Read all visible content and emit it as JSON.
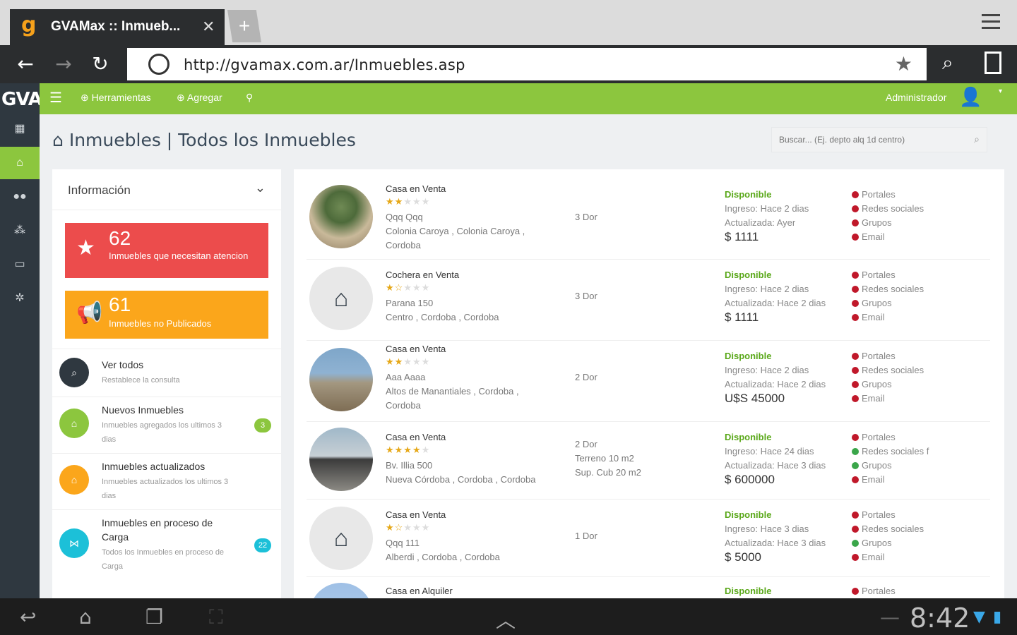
{
  "browser": {
    "tab_title": "GVAMax :: Inmueb...",
    "tab_close": "✕",
    "new_tab": "+",
    "url": "http://gvamax.com.ar/Inmuebles.asp"
  },
  "sidebar": {
    "logo": "GVA",
    "items": [
      "dashboard-icon",
      "home-icon",
      "users-icon",
      "network-icon",
      "calendar-icon",
      "gear-icon"
    ],
    "active_index": 1
  },
  "appbar": {
    "menu": "☰",
    "tools": "Herramientas",
    "add": "Agregar",
    "user": "Administrador"
  },
  "page": {
    "title": "Inmuebles | Todos los Inmuebles",
    "search_placeholder": "Buscar... (Ej. depto alq 1d centro)"
  },
  "info": {
    "title": "Información",
    "stat_attention": {
      "count": "62",
      "label": "Inmuebles que necesitan atencion"
    },
    "stat_unpublished": {
      "count": "61",
      "label": "Inmuebles no Publicados"
    },
    "rows": [
      {
        "title": "Ver todos",
        "subtitle": "Restablece la consulta",
        "badge": ""
      },
      {
        "title": "Nuevos Inmuebles",
        "subtitle": "Inmuebles agregados los ultimos 3 dias",
        "badge": "3"
      },
      {
        "title": "Inmuebles actualizados",
        "subtitle": "Inmuebles actualizados los ultimos 3 dias",
        "badge": ""
      },
      {
        "title": "Inmuebles en proceso de Carga",
        "subtitle": "Todos los Inmuebles en proceso de Carga",
        "badge": "22"
      }
    ],
    "colors": {
      "red": "#ec4c4c",
      "orange": "#fba61b",
      "dark": "#2f3840",
      "green": "#8cc63e",
      "cyan": "#1cc0d8"
    }
  },
  "properties": [
    {
      "type": "Casa en Venta",
      "stars": 2,
      "name": "Qqq Qqq",
      "address": "Colonia Caroya , Colonia Caroya ,",
      "address2": "Cordoba",
      "dor": "3 Dor",
      "dor2": "",
      "dor3": "",
      "status": "Disponible",
      "ingreso": "Ingreso: Hace 2 dias",
      "actualizada": "Actualizada: Ayer",
      "price": "$ 1111",
      "channels": [
        "Portales",
        "Redes sociales",
        "Grupos",
        "Email"
      ],
      "channel_ok": [
        false,
        false,
        false,
        false
      ]
    },
    {
      "type": "Cochera en Venta",
      "stars": 1.5,
      "name": "Parana 150",
      "address": "Centro , Cordoba , Cordoba",
      "address2": "",
      "dor": "3 Dor",
      "dor2": "",
      "dor3": "",
      "status": "Disponible",
      "ingreso": "Ingreso: Hace 2 dias",
      "actualizada": "Actualizada: Hace 2 dias",
      "price": "$ 1111",
      "channels": [
        "Portales",
        "Redes sociales",
        "Grupos",
        "Email"
      ],
      "channel_ok": [
        false,
        false,
        false,
        false
      ]
    },
    {
      "type": "Casa en Venta",
      "stars": 2,
      "name": "Aaa Aaaa",
      "address": "Altos de Manantiales , Cordoba ,",
      "address2": "Cordoba",
      "dor": "2 Dor",
      "dor2": "",
      "dor3": "",
      "status": "Disponible",
      "ingreso": "Ingreso: Hace 2 dias",
      "actualizada": "Actualizada: Hace 2 dias",
      "price": "U$S 45000",
      "channels": [
        "Portales",
        "Redes sociales",
        "Grupos",
        "Email"
      ],
      "channel_ok": [
        false,
        false,
        false,
        false
      ]
    },
    {
      "type": "Casa en Venta",
      "stars": 4,
      "name": "Bv. Illia 500",
      "address": "Nueva Córdoba , Cordoba , Cordoba",
      "address2": "",
      "dor": "2 Dor",
      "dor2": "Terreno 10 m2",
      "dor3": "Sup. Cub 20 m2",
      "status": "Disponible",
      "ingreso": "Ingreso: Hace 24 dias",
      "actualizada": "Actualizada: Hace 3 dias",
      "price": "$ 600000",
      "channels": [
        "Portales",
        "Redes sociales",
        "Grupos",
        "Email"
      ],
      "channel_ok": [
        false,
        true,
        true,
        false
      ]
    },
    {
      "type": "Casa en Venta",
      "stars": 1.5,
      "name": "Qqq 111",
      "address": "Alberdi , Cordoba , Cordoba",
      "address2": "",
      "dor": "1 Dor",
      "dor2": "",
      "dor3": "",
      "status": "Disponible",
      "ingreso": "Ingreso: Hace 3 dias",
      "actualizada": "Actualizada: Hace 3 dias",
      "price": "$ 5000",
      "channels": [
        "Portales",
        "Redes sociales",
        "Grupos",
        "Email"
      ],
      "channel_ok": [
        false,
        false,
        true,
        false
      ]
    },
    {
      "type": "Casa en Alquiler",
      "stars": 0,
      "name": "",
      "address": "",
      "address2": "",
      "dor": "",
      "dor2": "",
      "dor3": "",
      "status": "Disponible",
      "ingreso": "",
      "actualizada": "",
      "price": "",
      "channels": [
        "Portales"
      ],
      "channel_ok": [
        false
      ]
    }
  ],
  "system": {
    "clock": "8:42"
  }
}
